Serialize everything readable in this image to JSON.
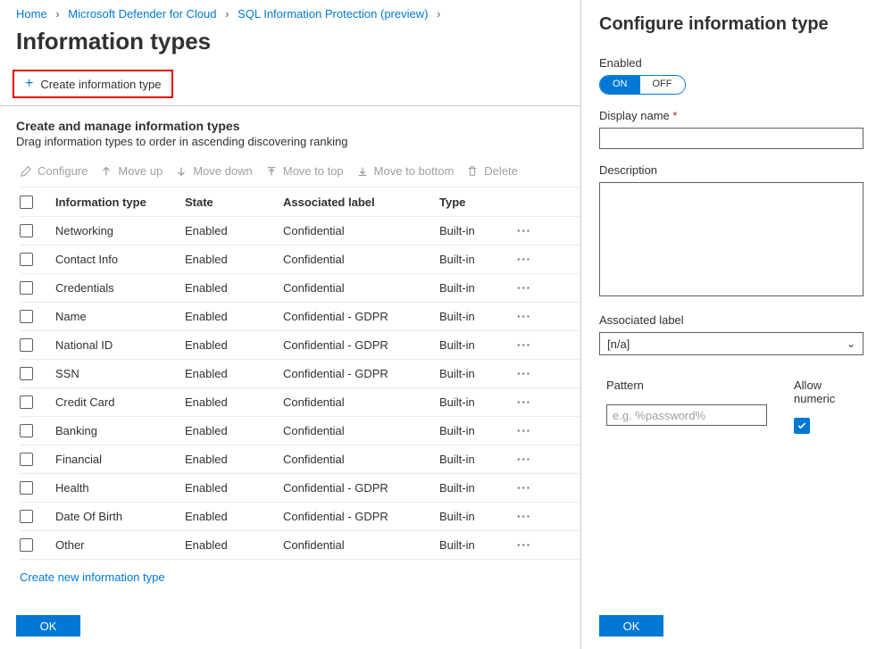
{
  "breadcrumb": {
    "items": [
      {
        "label": "Home"
      },
      {
        "label": "Microsoft Defender for Cloud"
      },
      {
        "label": "SQL Information Protection (preview)"
      }
    ]
  },
  "page_title": "Information types",
  "create_button": "Create information type",
  "subheader": {
    "title": "Create and manage information types",
    "desc": "Drag information types to order in ascending discovering ranking"
  },
  "toolbar": {
    "configure": "Configure",
    "move_up": "Move up",
    "move_down": "Move down",
    "move_top": "Move to top",
    "move_bottom": "Move to bottom",
    "delete": "Delete"
  },
  "table": {
    "headers": {
      "c1": "Information type",
      "c2": "State",
      "c3": "Associated label",
      "c4": "Type"
    },
    "rows": [
      {
        "c1": "Networking",
        "c2": "Enabled",
        "c3": "Confidential",
        "c4": "Built-in"
      },
      {
        "c1": "Contact Info",
        "c2": "Enabled",
        "c3": "Confidential",
        "c4": "Built-in"
      },
      {
        "c1": "Credentials",
        "c2": "Enabled",
        "c3": "Confidential",
        "c4": "Built-in"
      },
      {
        "c1": "Name",
        "c2": "Enabled",
        "c3": "Confidential - GDPR",
        "c4": "Built-in"
      },
      {
        "c1": "National ID",
        "c2": "Enabled",
        "c3": "Confidential - GDPR",
        "c4": "Built-in"
      },
      {
        "c1": "SSN",
        "c2": "Enabled",
        "c3": "Confidential - GDPR",
        "c4": "Built-in"
      },
      {
        "c1": "Credit Card",
        "c2": "Enabled",
        "c3": "Confidential",
        "c4": "Built-in"
      },
      {
        "c1": "Banking",
        "c2": "Enabled",
        "c3": "Confidential",
        "c4": "Built-in"
      },
      {
        "c1": "Financial",
        "c2": "Enabled",
        "c3": "Confidential",
        "c4": "Built-in"
      },
      {
        "c1": "Health",
        "c2": "Enabled",
        "c3": "Confidential - GDPR",
        "c4": "Built-in"
      },
      {
        "c1": "Date Of Birth",
        "c2": "Enabled",
        "c3": "Confidential - GDPR",
        "c4": "Built-in"
      },
      {
        "c1": "Other",
        "c2": "Enabled",
        "c3": "Confidential",
        "c4": "Built-in"
      }
    ]
  },
  "create_new_link": "Create new information type",
  "ok_label": "OK",
  "right": {
    "title": "Configure information type",
    "enabled_label": "Enabled",
    "toggle_on": "ON",
    "toggle_off": "OFF",
    "display_name_label": "Display name",
    "description_label": "Description",
    "associated_label": "Associated label",
    "associated_value": "[n/a]",
    "pattern_label": "Pattern",
    "pattern_placeholder": "e.g. %password%",
    "allow_numeric_label": "Allow numeric"
  }
}
